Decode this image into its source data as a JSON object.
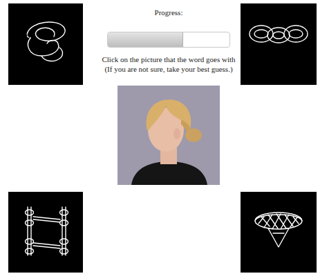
{
  "progress": {
    "label": "Progress:",
    "level": 0.62
  },
  "instructions": [
    "Click on the picture that the word goes with",
    "(If you are not sure, take your best guess.)"
  ],
  "choices": [
    {
      "kind": "knot"
    },
    {
      "kind": "chain"
    },
    {
      "kind": "frame"
    },
    {
      "kind": "lamp"
    }
  ]
}
